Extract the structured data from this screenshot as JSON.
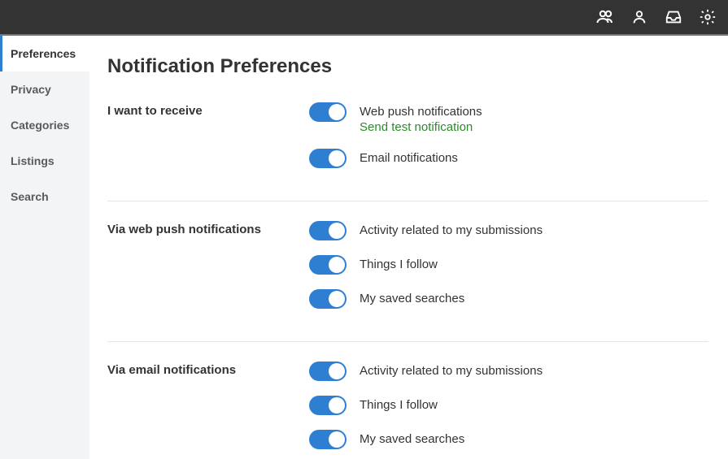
{
  "topbar": {
    "icons": [
      "team-icon",
      "user-icon",
      "inbox-icon",
      "gear-icon"
    ]
  },
  "sidebar": {
    "items": [
      {
        "label": "Preferences",
        "active": true
      },
      {
        "label": "Privacy",
        "active": false
      },
      {
        "label": "Categories",
        "active": false
      },
      {
        "label": "Listings",
        "active": false
      },
      {
        "label": "Search",
        "active": false
      }
    ]
  },
  "page": {
    "title": "Notification Preferences",
    "sections": [
      {
        "label": "I want to receive",
        "rows": [
          {
            "label": "Web push notifications",
            "on": true,
            "link": "Send test notification"
          },
          {
            "label": "Email notifications",
            "on": true
          }
        ]
      },
      {
        "label": "Via web push notifications",
        "rows": [
          {
            "label": "Activity related to my submissions",
            "on": true
          },
          {
            "label": "Things I follow",
            "on": true
          },
          {
            "label": "My saved searches",
            "on": true
          }
        ]
      },
      {
        "label": "Via email notifications",
        "rows": [
          {
            "label": "Activity related to my submissions",
            "on": true
          },
          {
            "label": "Things I follow",
            "on": true
          },
          {
            "label": "My saved searches",
            "on": true
          }
        ]
      }
    ]
  }
}
